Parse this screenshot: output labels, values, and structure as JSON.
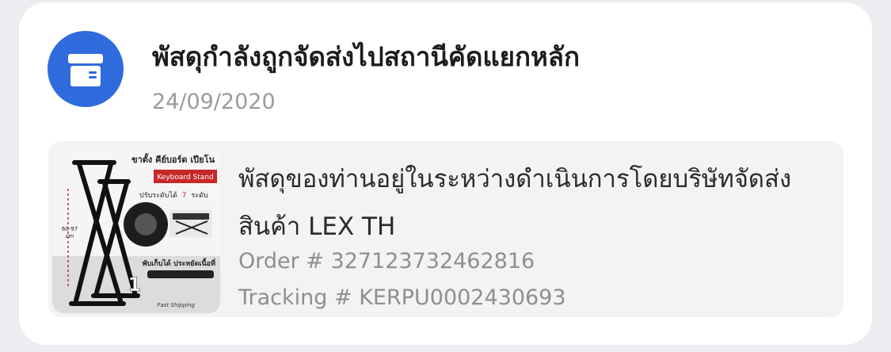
{
  "notification": {
    "icon": "package-box-icon",
    "icon_color": "#2f6bdc",
    "title": "พัสดุกำลังถูกจัดส่งไปสถานีคัดแยกหลัก",
    "date": "24/09/2020"
  },
  "details": {
    "message": "พัสดุของท่านอยู่ในระหว่างดำเนินการโดยบริษัทจัดส่งสินค้า LEX TH",
    "order": "Order # 327123732462816",
    "tracking": "Tracking # KERPU0002430693"
  },
  "product_image": {
    "headline": "ขาตั้ง คีย์บอร์ด เปียโน",
    "badge": "Keyboard Stand",
    "line1_prefix": "ปรับระดับได้",
    "line1_number": "7",
    "line1_suffix": "ระดับ",
    "height_label": "60-97",
    "height_unit": "cm",
    "line2": "พับเก็บได้ ประหยัดเนื้อที่",
    "count": "1",
    "footer": "Fast Shipping"
  }
}
